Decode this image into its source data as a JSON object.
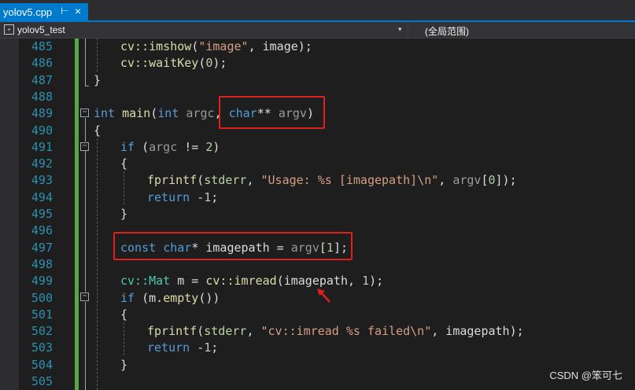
{
  "tab": {
    "filename": "yolov5.cpp",
    "pin_glyph": "⊢",
    "close_glyph": "×"
  },
  "navbar": {
    "project": "yolov5_test",
    "scope": "(全局范围)"
  },
  "line_numbers": [
    "485",
    "486",
    "487",
    "488",
    "489",
    "490",
    "491",
    "492",
    "493",
    "494",
    "495",
    "496",
    "497",
    "498",
    "499",
    "500",
    "501",
    "502",
    "503",
    "504",
    "505"
  ],
  "code": {
    "l485": [
      [
        "fn",
        "cv::imshow"
      ],
      [
        "",
        "("
      ],
      [
        "st",
        "\"image\""
      ],
      [
        "",
        ", image);"
      ]
    ],
    "l486": [
      [
        "fn",
        "cv::waitKey"
      ],
      [
        "",
        "("
      ],
      [
        "nu",
        "0"
      ],
      [
        "",
        ");"
      ]
    ],
    "l487": [
      [
        "",
        "}"
      ]
    ],
    "l488": [],
    "l489": [
      [
        "kw",
        "int"
      ],
      [
        "",
        " "
      ],
      [
        "fn",
        "main"
      ],
      [
        "",
        "("
      ],
      [
        "kw",
        "int"
      ],
      [
        "",
        " "
      ],
      [
        "pa",
        "argc"
      ],
      [
        "",
        ", "
      ],
      [
        "kw",
        "char"
      ],
      [
        "",
        "** "
      ],
      [
        "pa",
        "argv"
      ],
      [
        "",
        ")"
      ]
    ],
    "l490": [
      [
        "",
        "{"
      ]
    ],
    "l491": [
      [
        "kw",
        "if"
      ],
      [
        "",
        " ("
      ],
      [
        "pa",
        "argc"
      ],
      [
        "",
        " != "
      ],
      [
        "nu",
        "2"
      ],
      [
        "",
        ")"
      ]
    ],
    "l492": [
      [
        "",
        "{"
      ]
    ],
    "l493": [
      [
        "fn",
        "fprintf"
      ],
      [
        "",
        "("
      ],
      [
        "gl",
        "stderr"
      ],
      [
        "",
        ", "
      ],
      [
        "st",
        "\"Usage: %s [imagepath]\\n\""
      ],
      [
        "",
        ", "
      ],
      [
        "pa",
        "argv"
      ],
      [
        "",
        "["
      ],
      [
        "nu",
        "0"
      ],
      [
        "",
        "]);"
      ]
    ],
    "l494": [
      [
        "kw",
        "return"
      ],
      [
        "",
        " -"
      ],
      [
        "nu",
        "1"
      ],
      [
        "",
        ";"
      ]
    ],
    "l495": [
      [
        "",
        "}"
      ]
    ],
    "l496": [],
    "l497": [
      [
        "kw",
        "const"
      ],
      [
        "",
        " "
      ],
      [
        "kw",
        "char"
      ],
      [
        "",
        "* imagepath = "
      ],
      [
        "pa",
        "argv"
      ],
      [
        "",
        "["
      ],
      [
        "nu",
        "1"
      ],
      [
        "",
        "];"
      ]
    ],
    "l498": [],
    "l499": [
      [
        "ty",
        "cv::Mat"
      ],
      [
        "",
        " m = "
      ],
      [
        "fn",
        "cv::imread"
      ],
      [
        "",
        "(imagepath, "
      ],
      [
        "nu",
        "1"
      ],
      [
        "",
        ");"
      ]
    ],
    "l500": [
      [
        "kw",
        "if"
      ],
      [
        "",
        " (m."
      ],
      [
        "fn",
        "empty"
      ],
      [
        "",
        "())"
      ]
    ],
    "l501": [
      [
        "",
        "{"
      ]
    ],
    "l502": [
      [
        "fn",
        "fprintf"
      ],
      [
        "",
        "("
      ],
      [
        "gl",
        "stderr"
      ],
      [
        "",
        ", "
      ],
      [
        "st",
        "\"cv::imread %s failed\\n\""
      ],
      [
        "",
        ", imagepath);"
      ]
    ],
    "l503": [
      [
        "kw",
        "return"
      ],
      [
        "",
        " -"
      ],
      [
        "nu",
        "1"
      ],
      [
        "",
        ";"
      ]
    ],
    "l504": [
      [
        "",
        "}"
      ]
    ],
    "l505": []
  },
  "watermark": "CSDN @笨可七",
  "colors": {
    "accent": "#007acc",
    "highlight_box": "#e0201e",
    "change_bar": "#57a64a",
    "line_number": "#2b91af"
  }
}
